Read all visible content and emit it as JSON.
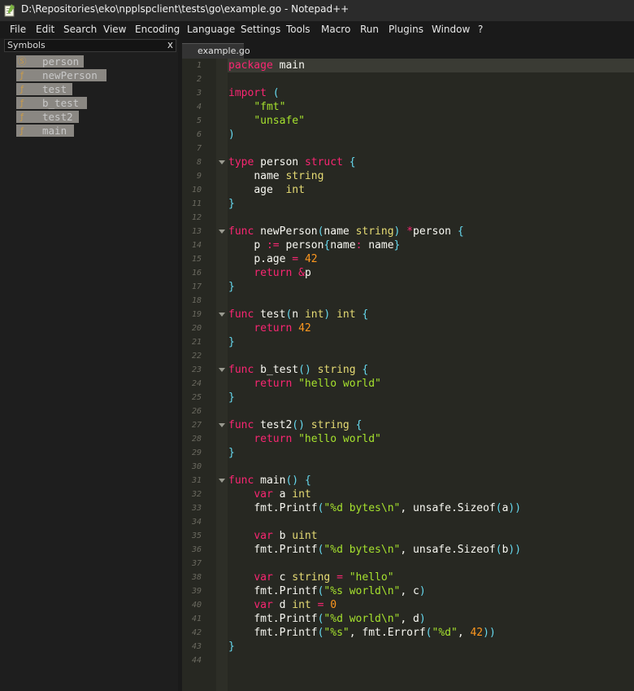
{
  "window": {
    "title": "D:\\Repositories\\eko\\npplspclient\\tests\\go\\example.go - Notepad++"
  },
  "menu": [
    "File",
    "Edit",
    "Search",
    "View",
    "Encoding",
    "Language",
    "Settings",
    "Tools",
    "Macro",
    "Run",
    "Plugins",
    "Window",
    "?"
  ],
  "symbols_panel": {
    "title": "Symbols",
    "close": "x",
    "items": [
      {
        "icon": "Ⓢ",
        "label": "person"
      },
      {
        "icon": "ƒ",
        "label": "newPerson"
      },
      {
        "icon": "ƒ",
        "label": "test"
      },
      {
        "icon": "ƒ",
        "label": "b_test"
      },
      {
        "icon": "ƒ",
        "label": "test2"
      },
      {
        "icon": "ƒ",
        "label": "main"
      }
    ]
  },
  "tab": {
    "label": "example.go"
  },
  "colors": {
    "keyword": "#f92672",
    "type": "#e6db74",
    "string": "#a6e22e",
    "number": "#fd971f",
    "punct": "#66d9ef",
    "ident": "#f8f8f2"
  },
  "code": [
    "package main",
    "",
    "import (",
    "    \"fmt\"",
    "    \"unsafe\"",
    ")",
    "",
    "type person struct {",
    "    name string",
    "    age  int",
    "}",
    "",
    "func newPerson(name string) *person {",
    "    p := person{name: name}",
    "    p.age = 42",
    "    return &p",
    "}",
    "",
    "func test(n int) int {",
    "    return 42",
    "}",
    "",
    "func b_test() string {",
    "    return \"hello world\"",
    "}",
    "",
    "func test2() string {",
    "    return \"hello world\"",
    "}",
    "",
    "func main() {",
    "    var a int",
    "    fmt.Printf(\"%d bytes\\n\", unsafe.Sizeof(a))",
    "",
    "    var b uint",
    "    fmt.Printf(\"%d bytes\\n\", unsafe.Sizeof(b))",
    "",
    "    var c string = \"hello\"",
    "    fmt.Printf(\"%s world\\n\", c)",
    "    var d int = 0",
    "    fmt.Printf(\"%d world\\n\", d)",
    "    fmt.Printf(\"%s\", fmt.Errorf(\"%d\", 42))",
    "}",
    ""
  ],
  "fold_lines": [
    8,
    13,
    19,
    23,
    27,
    31
  ]
}
